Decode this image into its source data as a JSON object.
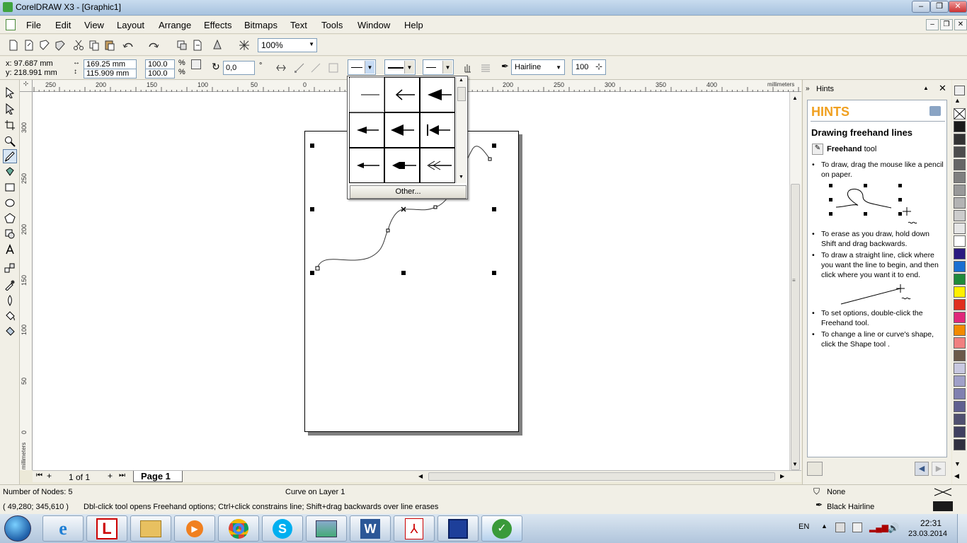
{
  "window": {
    "title": "CorelDRAW X3 - [Graphic1]",
    "minimize": "–",
    "maximize": "❐",
    "close": "✕"
  },
  "menu": {
    "items": [
      "File",
      "Edit",
      "View",
      "Layout",
      "Arrange",
      "Effects",
      "Bitmaps",
      "Text",
      "Tools",
      "Window",
      "Help"
    ]
  },
  "toolbar": {
    "zoom": "100%"
  },
  "propbar": {
    "x": "x: 97.687 mm",
    "y": "y: 218.991 mm",
    "width": "169.25 mm",
    "height": "115.909 mm",
    "scale_x": "100.0",
    "scale_y": "100.0",
    "percent": "%",
    "rotation": "0,0",
    "degree": "°",
    "outline_width": "Hairline",
    "smoothing": "100"
  },
  "ruler": {
    "unit": "millimeters",
    "h_ticks": [
      "250",
      "200",
      "150",
      "100",
      "50",
      "0",
      "200",
      "250",
      "300",
      "350",
      "400"
    ],
    "v_ticks": [
      "300",
      "250",
      "200",
      "150",
      "100",
      "50",
      "0"
    ]
  },
  "arrow_dropdown": {
    "other_button": "Other..."
  },
  "pages": {
    "count_text": "1 of 1",
    "tab": "Page 1"
  },
  "docker": {
    "title": "Hints",
    "heading": "HINTS",
    "subheading": "Drawing freehand lines",
    "tool_name": "Freehand",
    "tool_word": "tool",
    "tips": [
      "To draw, drag the mouse like a pencil on paper.",
      "To erase as you draw, hold down Shift and drag backwards.",
      "To draw a straight line, click where you want the line to begin, and then click where you want it to end.",
      "To set options, double-click the Freehand tool.",
      "To change a line or curve's shape, click the Shape tool ."
    ]
  },
  "palette": {
    "colors": [
      "#1a1a1a",
      "#333333",
      "#4d4d4d",
      "#666666",
      "#808080",
      "#999999",
      "#b3b3b3",
      "#cccccc",
      "#e6e6e6",
      "#ffffff",
      "#2a1a80",
      "#1a6fd1",
      "#1f8a3a",
      "#ffef00",
      "#e0301e",
      "#e0287a",
      "#f28a00",
      "#f08080",
      "#6b5a4a",
      "#c8c8e0",
      "#a0a0c8",
      "#8080b0",
      "#606090",
      "#505070",
      "#404060",
      "#303040"
    ]
  },
  "status": {
    "nodes": "Number of Nodes: 5",
    "layer": "Curve on Layer 1",
    "coords": "( 49,280; 345,610 )",
    "hint": "Dbl-click tool opens Freehand options; Ctrl+click constrains line; Shift+drag backwards over line erases",
    "fill": "None",
    "outline": "Black  Hairline"
  },
  "taskbar": {
    "lang": "EN",
    "time": "22:31",
    "date": "23.03.2014"
  }
}
